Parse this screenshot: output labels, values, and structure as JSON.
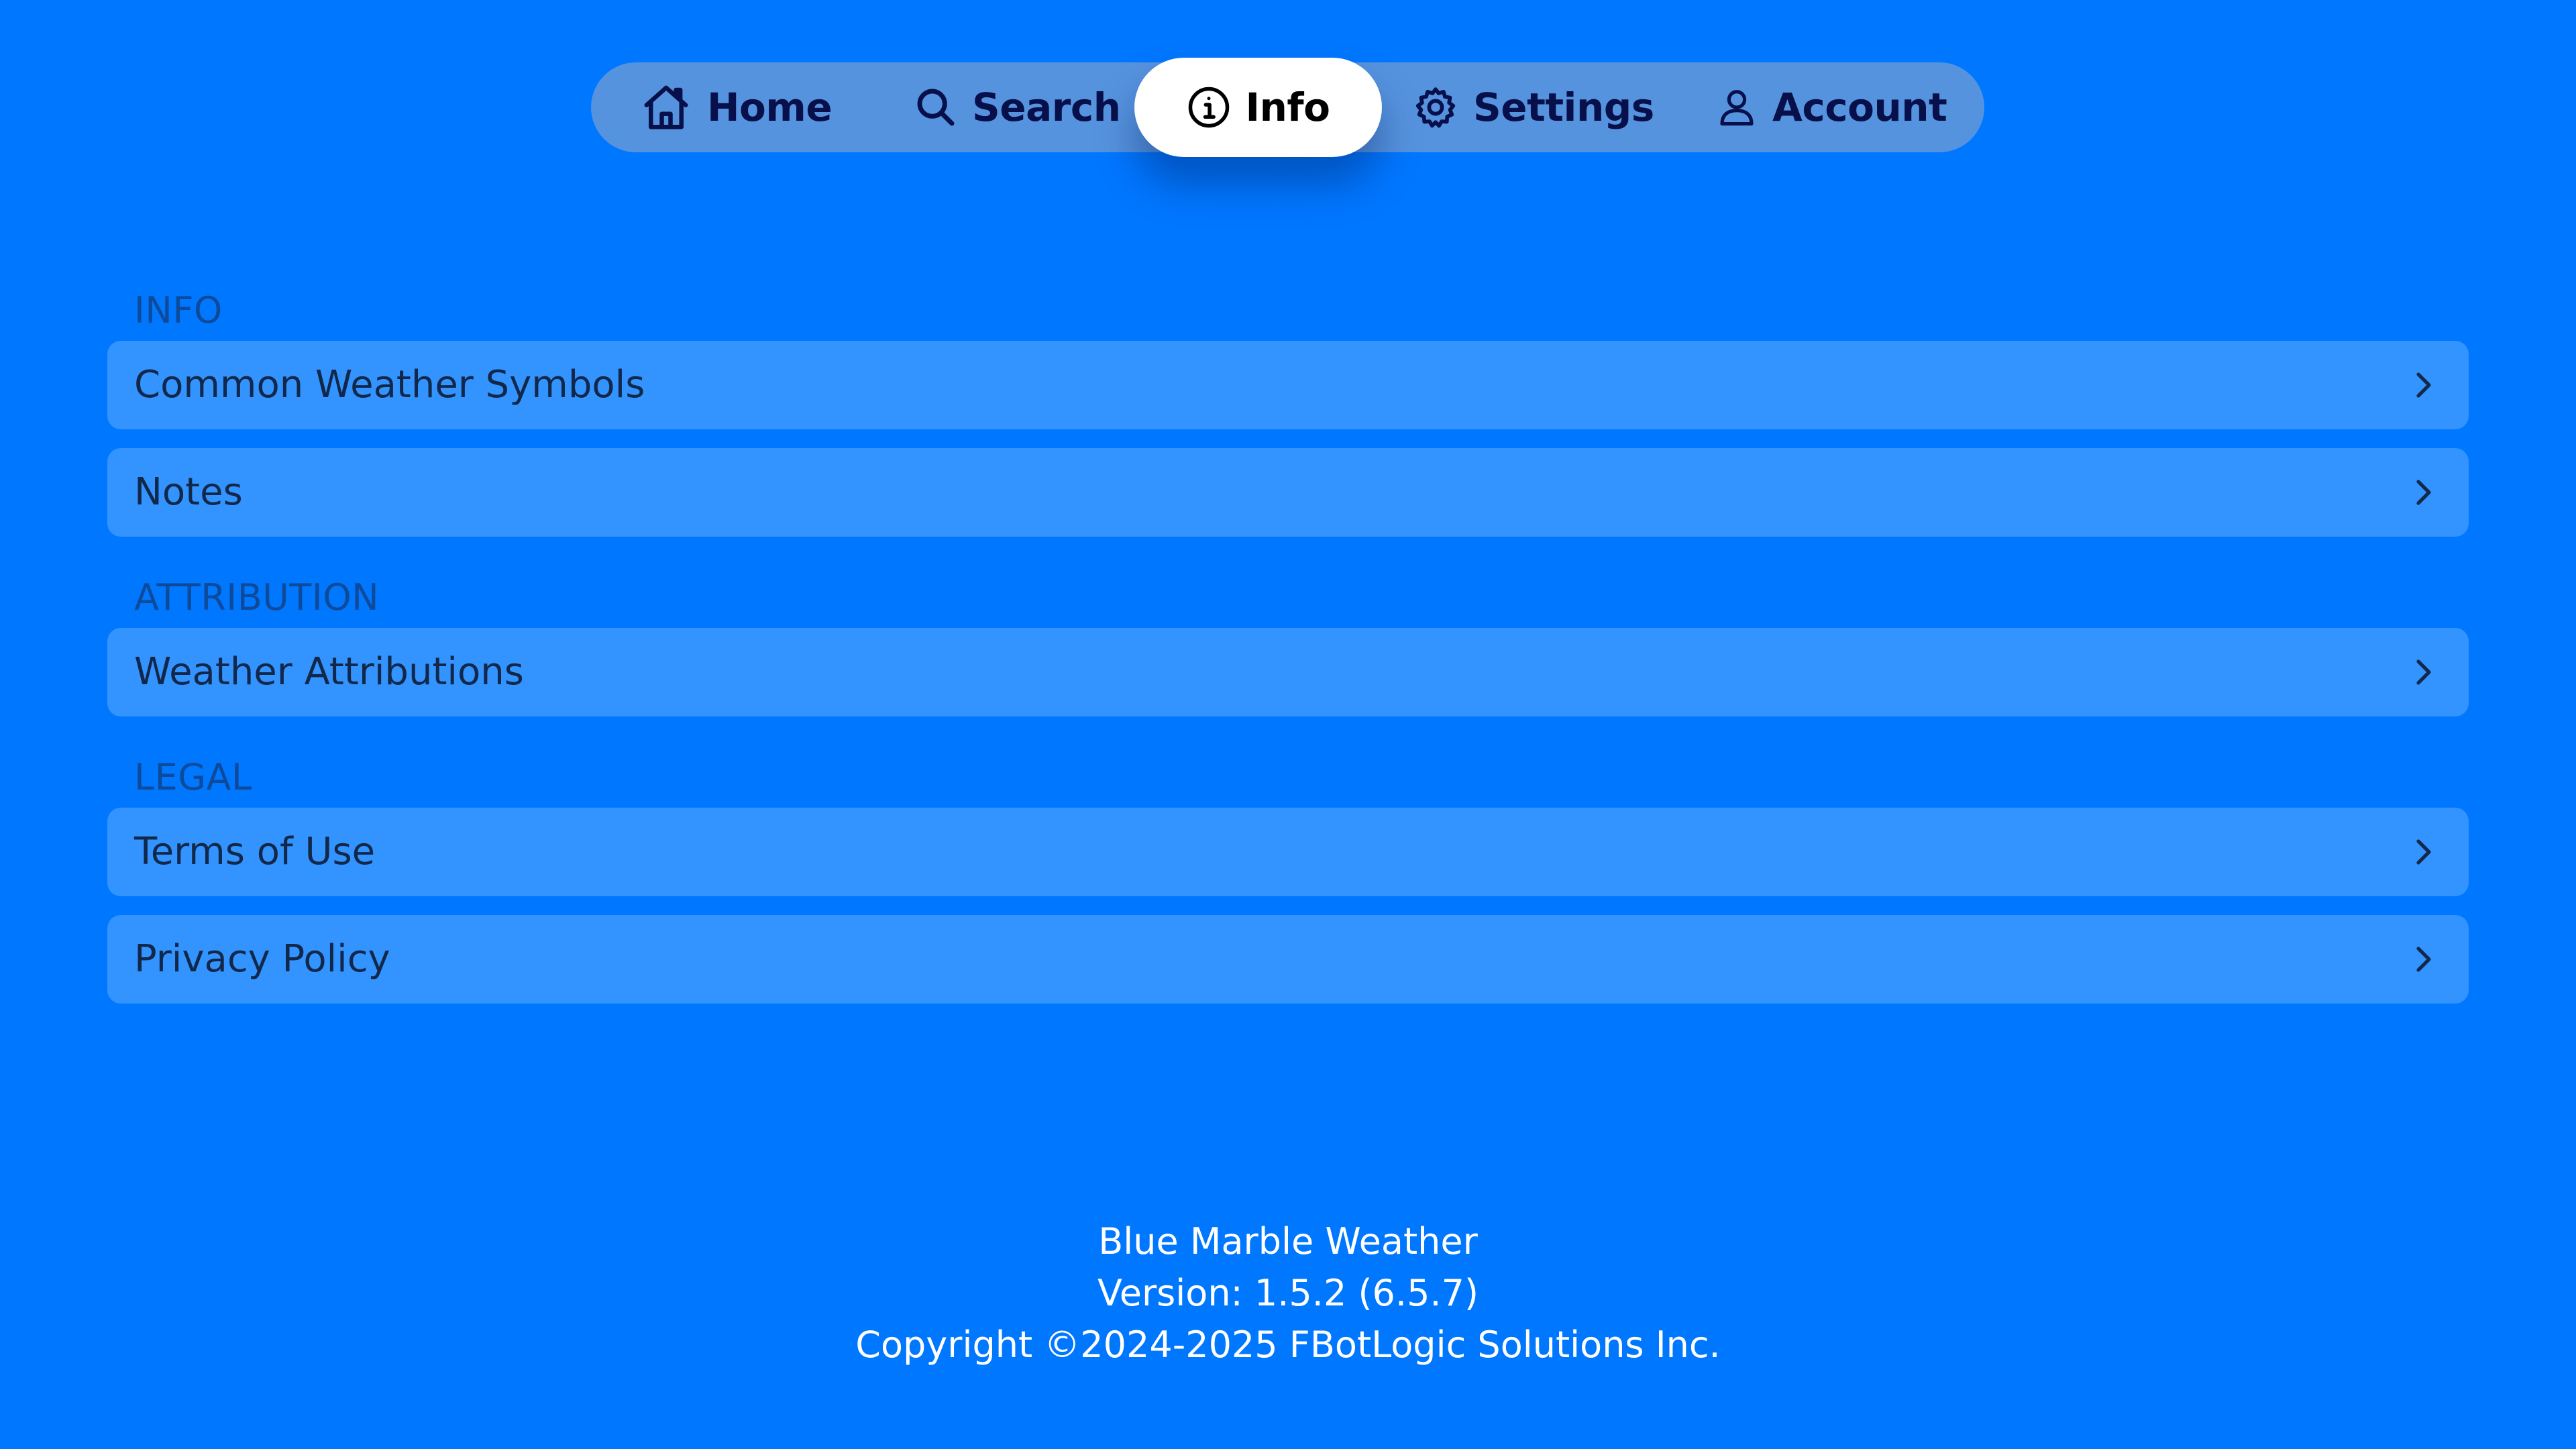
{
  "tabbar": {
    "tabs": [
      {
        "label": "Home",
        "icon": "house-icon",
        "active": false
      },
      {
        "label": "Search",
        "icon": "magnifier-icon",
        "active": false
      },
      {
        "label": "Info",
        "icon": "info-circle-icon",
        "active": true
      },
      {
        "label": "Settings",
        "icon": "gear-icon",
        "active": false
      },
      {
        "label": "Account",
        "icon": "person-icon",
        "active": false
      }
    ]
  },
  "sections": [
    {
      "header": "INFO",
      "items": [
        {
          "label": "Common Weather Symbols"
        },
        {
          "label": "Notes"
        }
      ]
    },
    {
      "header": "ATTRIBUTION",
      "items": [
        {
          "label": "Weather Attributions"
        }
      ]
    },
    {
      "header": "LEGAL",
      "items": [
        {
          "label": "Terms of Use"
        },
        {
          "label": "Privacy Policy"
        }
      ]
    }
  ],
  "footer": {
    "app_name": "Blue Marble Weather",
    "version": "Version: 1.5.2 (6.5.7)",
    "copyright": "Copyright ©2024-2025 FBotLogic Solutions Inc."
  },
  "colors": {
    "background": "#0077FF",
    "row_background": "#3394FF",
    "tab_text": "#07104A",
    "section_header": "#0E4A9A"
  }
}
